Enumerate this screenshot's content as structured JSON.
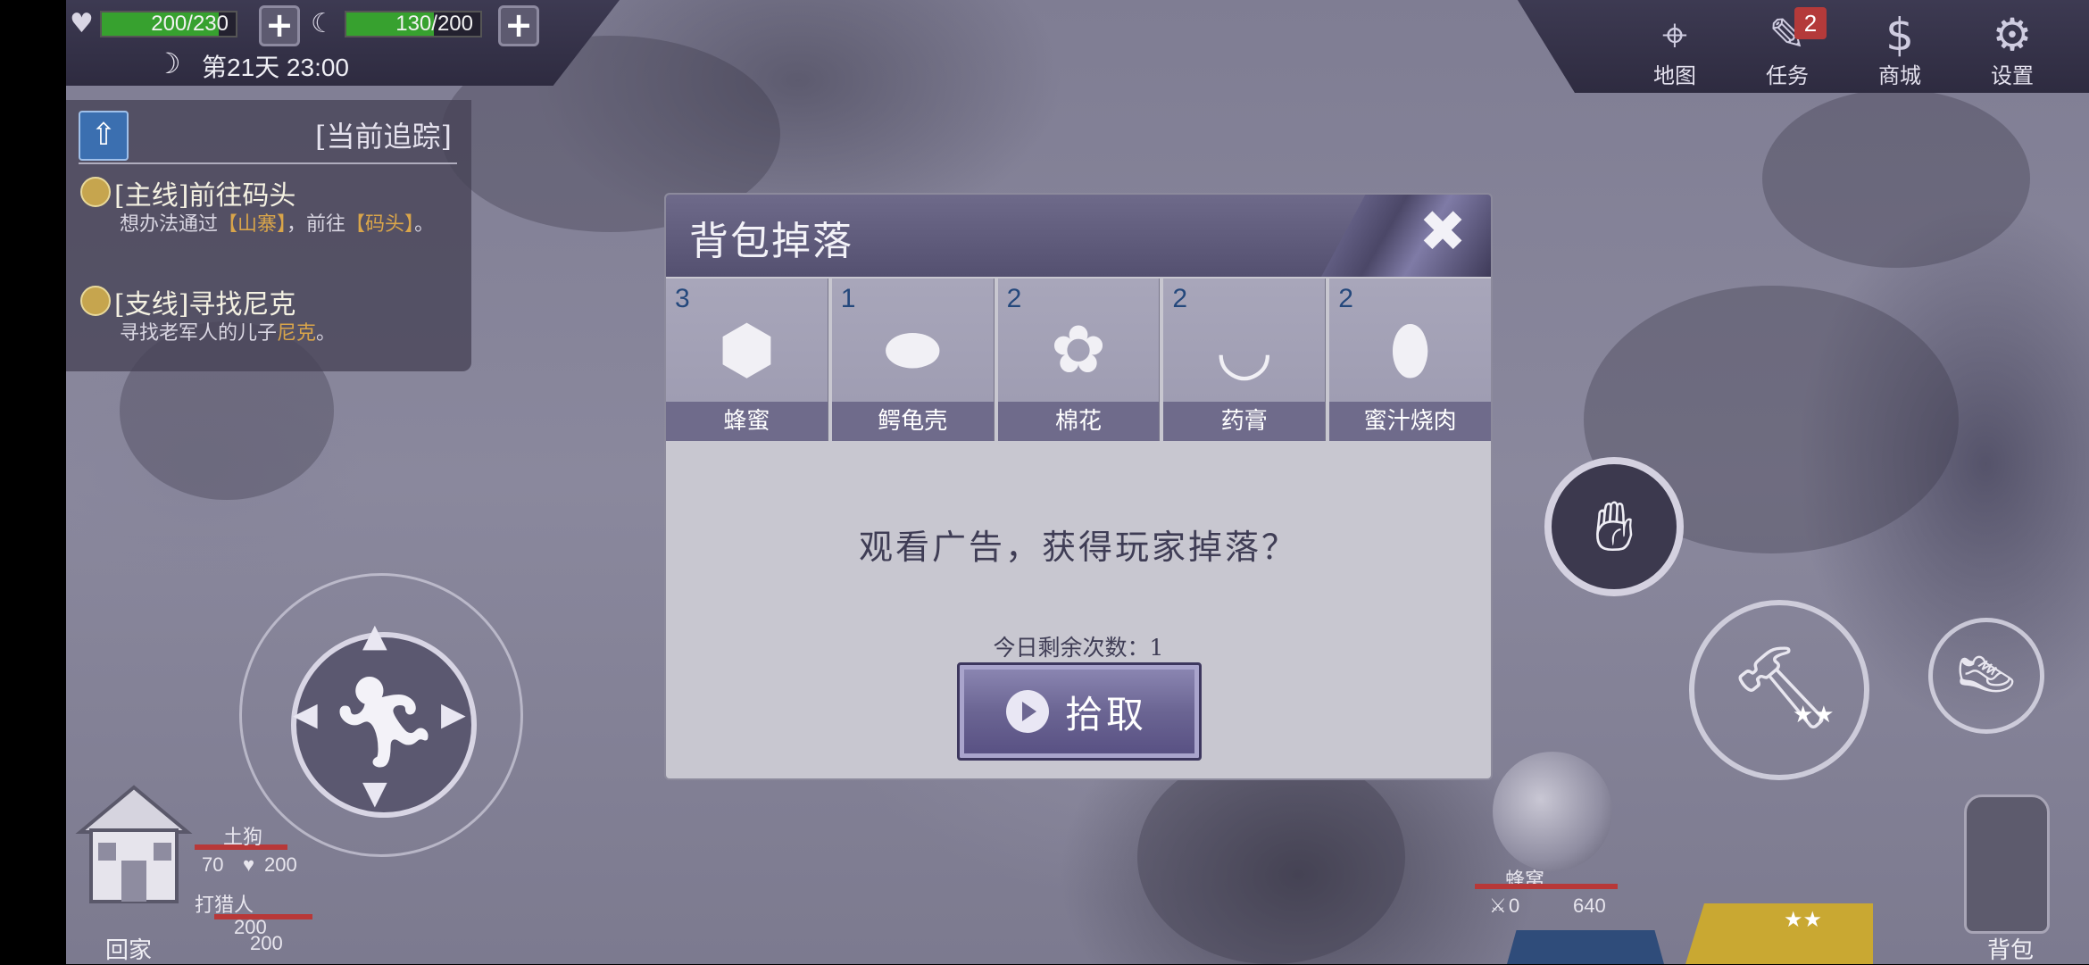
{
  "hud": {
    "health": {
      "value": "200/230",
      "fraction": 0.87
    },
    "hunger": {
      "value": "130/200",
      "fraction": 0.65
    },
    "day_time": "第21天 23:00"
  },
  "tracking": {
    "header": "[当前追踪]",
    "quests": [
      {
        "title": "[主线]前往码头",
        "desc_pre": "想办法通过",
        "desc_hl1": "【山寨】",
        "desc_mid": "，前往",
        "desc_hl2": "【码头】",
        "desc_post": "。"
      },
      {
        "title": "[支线]寻找尼克",
        "desc_pre": "寻找老军人的儿子",
        "desc_hl1": "尼克",
        "desc_post": "。"
      }
    ]
  },
  "menu": {
    "items": [
      {
        "label": "地图",
        "icon": "map-icon"
      },
      {
        "label": "任务",
        "icon": "quest-icon",
        "badge": "2"
      },
      {
        "label": "商城",
        "icon": "shop-icon"
      },
      {
        "label": "设置",
        "icon": "settings-icon"
      }
    ]
  },
  "dialog": {
    "title": "背包掉落",
    "items": [
      {
        "count": "3",
        "name": "蜂蜜",
        "icon": "honeycomb-icon"
      },
      {
        "count": "1",
        "name": "鳄龟壳",
        "icon": "turtle-shell-icon"
      },
      {
        "count": "2",
        "name": "棉花",
        "icon": "cotton-icon"
      },
      {
        "count": "2",
        "name": "药膏",
        "icon": "ointment-bowl-icon"
      },
      {
        "count": "2",
        "name": "蜜汁烧肉",
        "icon": "roast-meat-icon"
      }
    ],
    "question": "观看广告，获得玩家掉落？",
    "remaining": "今日剩余次数：1",
    "pick_label": "拾取"
  },
  "bottom": {
    "home_label": "回家",
    "bag_label": "背包",
    "enemy_left": {
      "name": "土狗",
      "atk": "70",
      "hp": "200"
    },
    "enemy_left2": {
      "name": "打猎人",
      "hp1": "200",
      "hp2": "200"
    },
    "enemy_right": {
      "name": "蜂窝",
      "atk": "0",
      "hp": "640"
    }
  },
  "colors": {
    "accent": "#6e6a8a",
    "health": "#37a12f",
    "quest_highlight": "#d9a54a",
    "badge": "#b43a3a"
  }
}
